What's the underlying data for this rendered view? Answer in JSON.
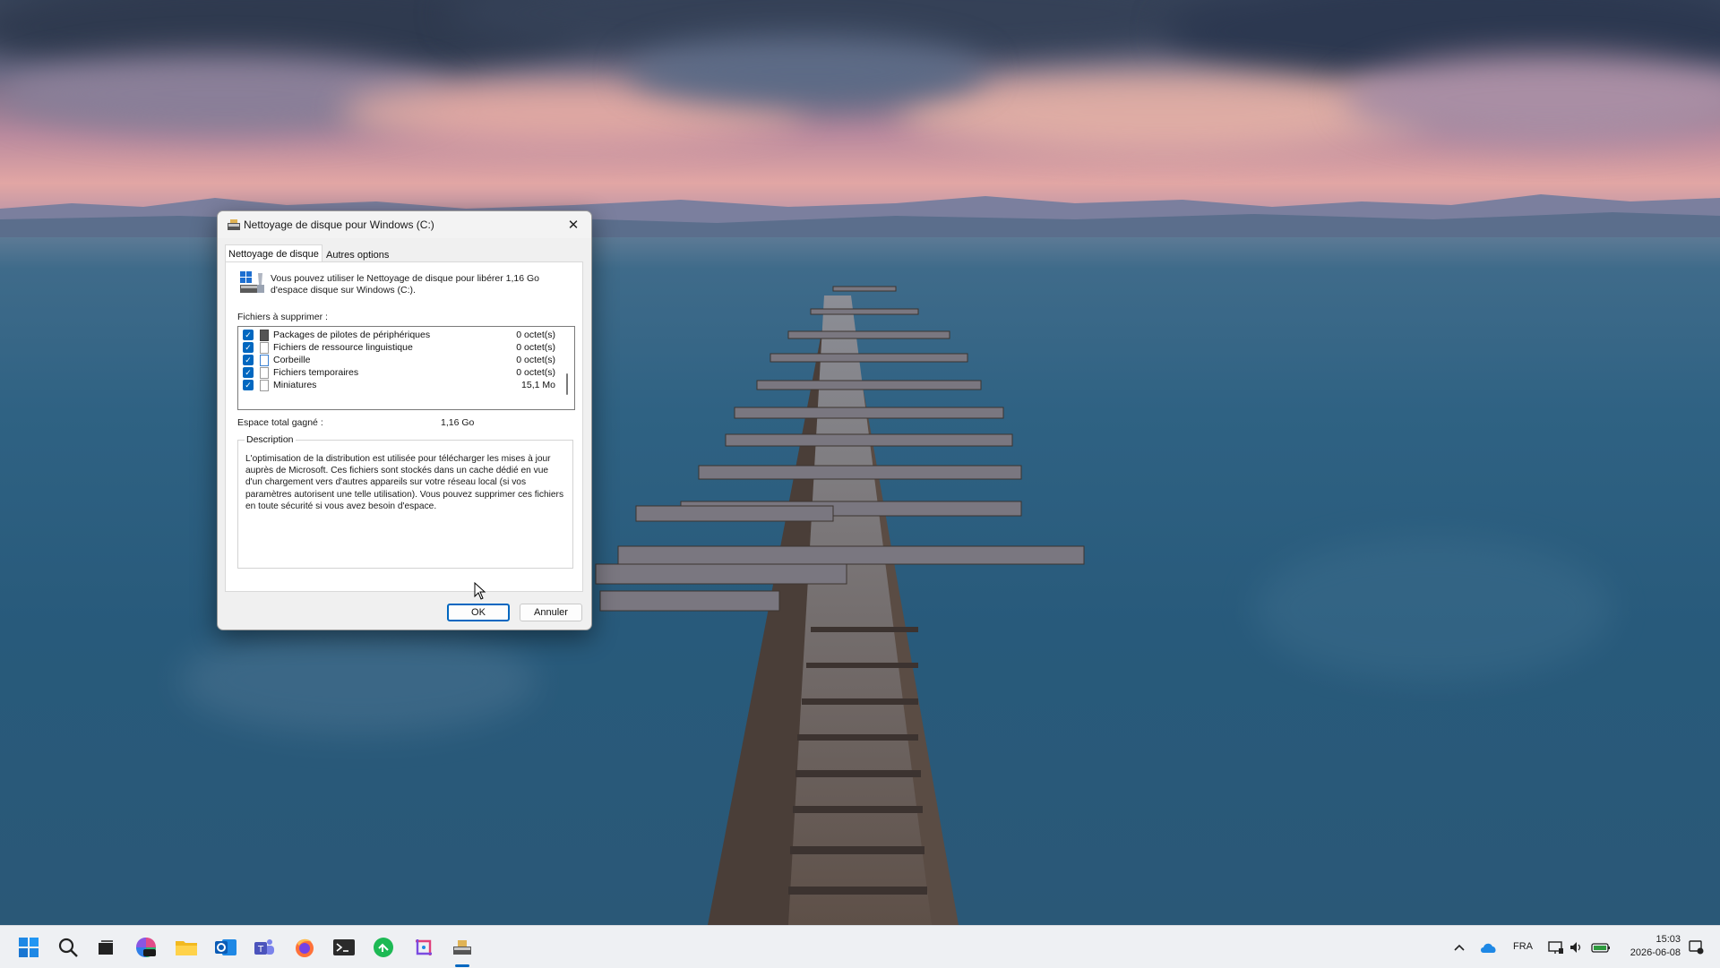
{
  "dialog": {
    "title": "Nettoyage de disque pour Windows (C:)",
    "close_glyph": "✕",
    "tabs": [
      {
        "label": "Nettoyage de disque",
        "active": true
      },
      {
        "label": "Autres options",
        "active": false
      }
    ],
    "intro": "Vous pouvez utiliser le Nettoyage de disque pour libérer 1,16 Go d'espace disque sur Windows (C:).",
    "files_label": "Fichiers à supprimer :",
    "files": [
      {
        "name": "Packages de pilotes de périphériques",
        "size": "0 octet(s)",
        "checked": true,
        "icon": "driver-package-icon"
      },
      {
        "name": "Fichiers de ressource linguistique",
        "size": "0 octet(s)",
        "checked": true,
        "icon": "file-icon"
      },
      {
        "name": "Corbeille",
        "size": "0 octet(s)",
        "checked": true,
        "icon": "recycle-bin-icon"
      },
      {
        "name": "Fichiers temporaires",
        "size": "0 octet(s)",
        "checked": true,
        "icon": "file-icon"
      },
      {
        "name": "Miniatures",
        "size": "15,1 Mo",
        "checked": true,
        "icon": "file-icon"
      }
    ],
    "total_label": "Espace total gagné :",
    "total_value": "1,16 Go",
    "description_legend": "Description",
    "description": "L'optimisation de la distribution est utilisée pour télécharger les mises à jour auprès de Microsoft. Ces fichiers sont stockés dans un cache dédié en vue d'un chargement vers d'autres appareils sur votre réseau local (si vos paramètres autorisent une telle utilisation). Vous pouvez supprimer ces fichiers en toute sécurité si vous avez besoin d'espace.",
    "ok_label": "OK",
    "cancel_label": "Annuler"
  },
  "taskbar": {
    "icons": [
      "windows-start-icon",
      "search-icon",
      "task-view-icon",
      "microsoft-365-icon",
      "file-explorer-icon",
      "outlook-icon",
      "teams-icon",
      "firefox-icon",
      "terminal-icon",
      "green-app-icon",
      "snipping-tool-icon",
      "disk-cleanup-icon"
    ],
    "tray": {
      "language": "FRA",
      "time": "15:03",
      "date": "2026-06-08"
    }
  },
  "colors": {
    "accent": "#0067c0",
    "taskbar": "#eef0f3"
  }
}
